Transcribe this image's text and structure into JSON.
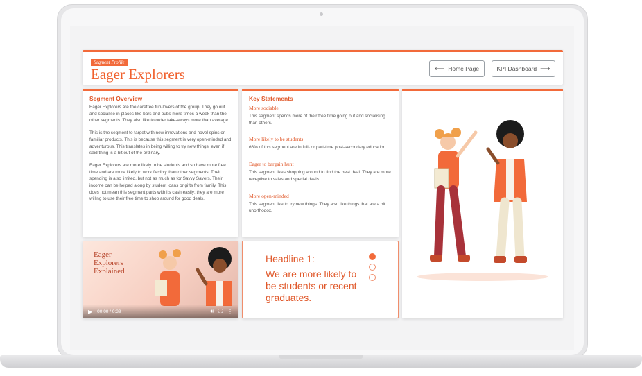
{
  "header": {
    "tag": "Segment Profile",
    "title": "Eager Explorers",
    "home_button": "Home Page",
    "kpi_button": "KPI Dashboard"
  },
  "overview": {
    "title": "Segment Overview",
    "paragraphs": [
      "Eager Explorers are the carefree fun-lovers of the group. They go out and socialise in places like bars and pubs more times a week than the other segments. They also like to order take-aways more than average.",
      "This is the segment to target with new innovations and novel spins on familiar products. This is because this segment is very open-minded and adventurous. This translates in being willing to try new things, even if said thing is a bit out of the ordinary.",
      "Eager Explorers are more likely to be students and so have more free time and are more likely to work flexibly than other segments. Their spending is also limited, but not as much as for Savvy Savers. Their income can be helped along by student loans or gifts from family. This does not mean this segment parts with its cash easily; they are more willing to use their free time to shop around for good deals."
    ]
  },
  "key_statements": {
    "title": "Key Statements",
    "items": [
      {
        "heading": "More sociable",
        "text": "This segment spends more of their free time going out and socialising than others."
      },
      {
        "heading": "More likely to be students",
        "text": "66% of this segment are in full- or part-time post-secondary education."
      },
      {
        "heading": "Eager to bargain hunt",
        "text": "This segment likes shopping around to find the best deal. They are more receptive to sales and special deals."
      },
      {
        "heading": "More open-minded",
        "text": "This segment like to try new things. They also like things that are a bit unorthodox."
      }
    ]
  },
  "video": {
    "title": "Eager Explorers Explained",
    "time": "00:00 / 0:39"
  },
  "headline": {
    "title": "Headline 1:",
    "text": "We are more likely to be students or recent graduates.",
    "active_index": 0,
    "count": 3
  },
  "colors": {
    "accent": "#f26a3a",
    "accent_text": "#e0582a"
  }
}
